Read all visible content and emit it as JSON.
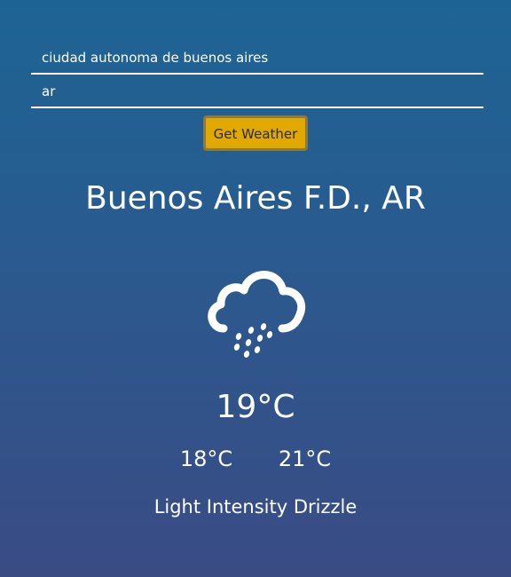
{
  "search": {
    "city_value": "ciudad autonoma de buenos aires",
    "country_value": "ar",
    "button_label": "Get Weather"
  },
  "weather": {
    "location": "Buenos Aires F.D., AR",
    "icon": "rain-cloud-icon",
    "temperature": "19°C",
    "temp_min": "18°C",
    "temp_max": "21°C",
    "description": "Light Intensity Drizzle"
  },
  "colors": {
    "background_top": "#1d6494",
    "background_bottom": "#3a4b84",
    "button_bg": "#e0a800",
    "text": "#ffffff"
  }
}
